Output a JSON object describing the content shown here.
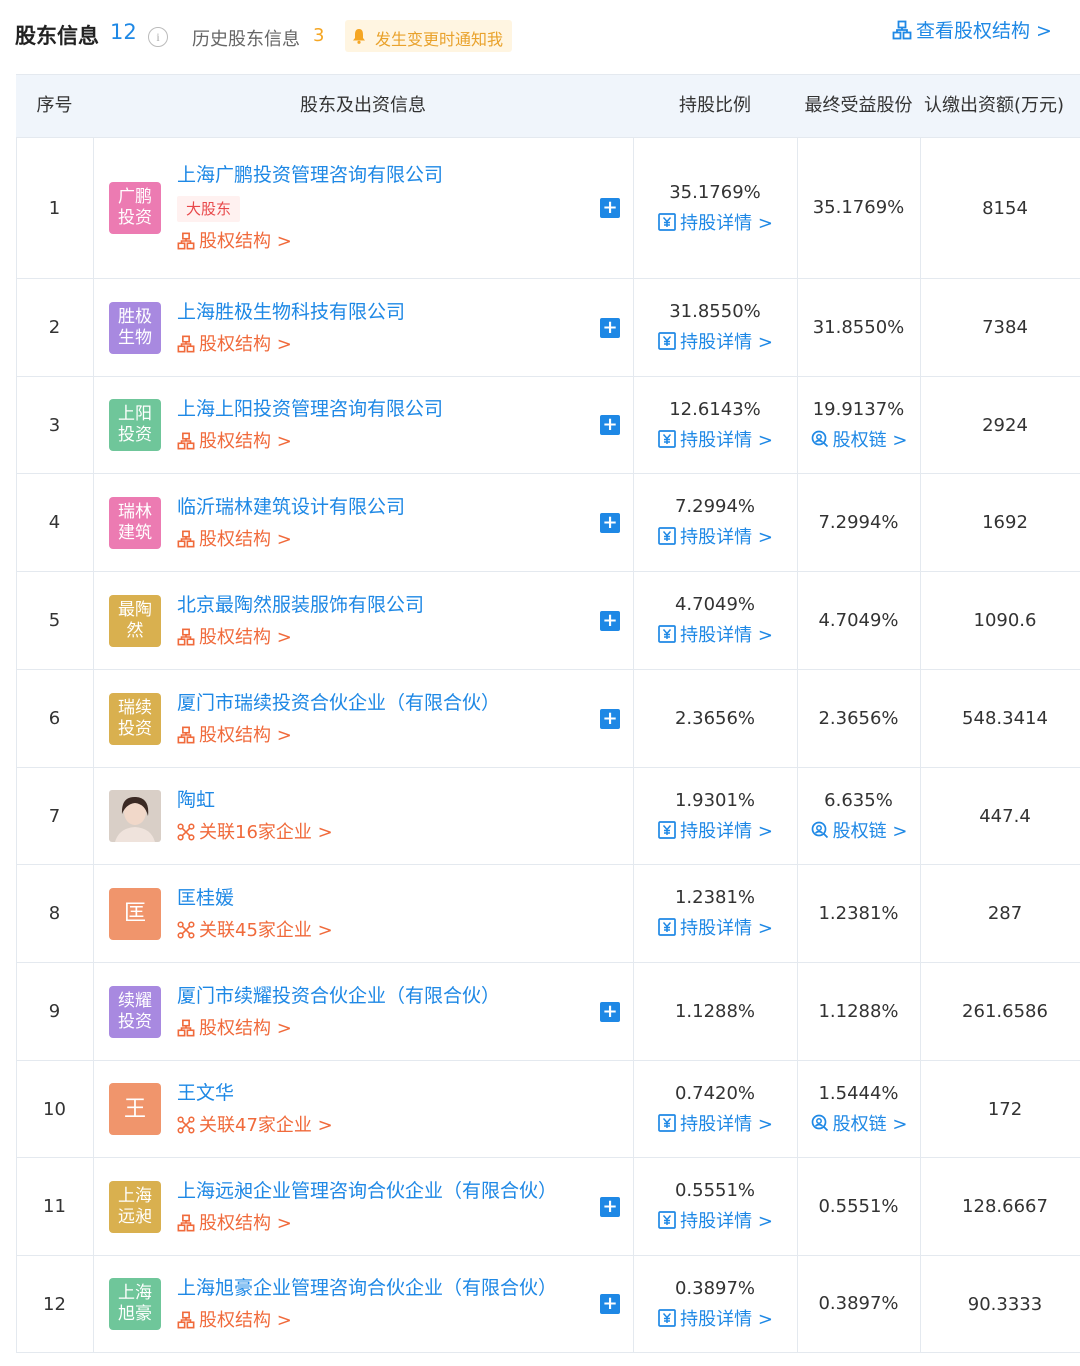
{
  "header": {
    "title": "股东信息",
    "count": "12",
    "info_icon": "i",
    "history_label": "历史股东信息",
    "history_count": "3",
    "notify_label": "发生变更时通知我",
    "view_structure_label": "查看股权结构 >"
  },
  "table": {
    "columns": [
      "序号",
      "股东及出资信息",
      "持股比例",
      "最终受益股份",
      "认缴出资额(万元)"
    ],
    "rows": [
      {
        "index": "1",
        "logo": "广鹏\n投资",
        "logo_color": "#ec7bb2",
        "name": "上海广鹏投资管理咨询有限公司",
        "tag": "大股东",
        "sub_type": "struct",
        "sub_label": "股权结构 >",
        "plus": true,
        "ratio": "35.1769%",
        "ratio_link": "持股详情 >",
        "benefit": "35.1769%",
        "benefit_link": "",
        "capital": "8154",
        "h": 140
      },
      {
        "index": "2",
        "logo": "胜极\n生物",
        "logo_color": "#a889e0",
        "name": "上海胜极生物科技有限公司",
        "tag": "",
        "sub_type": "struct",
        "sub_label": "股权结构 >",
        "plus": true,
        "ratio": "31.8550%",
        "ratio_link": "持股详情 >",
        "benefit": "31.8550%",
        "benefit_link": "",
        "capital": "7384",
        "h": 97
      },
      {
        "index": "3",
        "logo": "上阳\n投资",
        "logo_color": "#6fc69a",
        "name": "上海上阳投资管理咨询有限公司",
        "tag": "",
        "sub_type": "struct",
        "sub_label": "股权结构 >",
        "plus": true,
        "ratio": "12.6143%",
        "ratio_link": "持股详情 >",
        "benefit": "19.9137%",
        "benefit_link": "股权链 >",
        "capital": "2924",
        "h": 96
      },
      {
        "index": "4",
        "logo": "瑞林\n建筑",
        "logo_color": "#ec7bb2",
        "name": "临沂瑞林建筑设计有限公司",
        "tag": "",
        "sub_type": "struct",
        "sub_label": "股权结构 >",
        "plus": true,
        "ratio": "7.2994%",
        "ratio_link": "持股详情 >",
        "benefit": "7.2994%",
        "benefit_link": "",
        "capital": "1692",
        "h": 97
      },
      {
        "index": "5",
        "logo": "最陶\n然",
        "logo_color": "#d9b04f",
        "name": "北京最陶然服装服饰有限公司",
        "tag": "",
        "sub_type": "struct",
        "sub_label": "股权结构 >",
        "plus": true,
        "ratio": "4.7049%",
        "ratio_link": "持股详情 >",
        "benefit": "4.7049%",
        "benefit_link": "",
        "capital": "1090.6",
        "h": 97
      },
      {
        "index": "6",
        "logo": "瑞续\n投资",
        "logo_color": "#d9b04f",
        "name": "厦门市瑞续投资合伙企业（有限合伙）",
        "tag": "",
        "sub_type": "struct",
        "sub_label": "股权结构 >",
        "plus": true,
        "ratio": "2.3656%",
        "ratio_link": "",
        "benefit": "2.3656%",
        "benefit_link": "",
        "capital": "548.3414",
        "h": 97
      },
      {
        "index": "7",
        "logo": "",
        "logo_color": "",
        "avatar": true,
        "name": "陶虹",
        "tag": "",
        "sub_type": "assoc",
        "sub_label": "关联16家企业 >",
        "plus": false,
        "ratio": "1.9301%",
        "ratio_link": "持股详情 >",
        "benefit": "6.635%",
        "benefit_link": "股权链 >",
        "capital": "447.4",
        "h": 96
      },
      {
        "index": "8",
        "logo": "匡",
        "logo_color": "#f0956c",
        "name": "匡桂媛",
        "tag": "",
        "sub_type": "assoc",
        "sub_label": "关联45家企业 >",
        "plus": false,
        "ratio": "1.2381%",
        "ratio_link": "持股详情 >",
        "benefit": "1.2381%",
        "benefit_link": "",
        "capital": "287",
        "h": 97
      },
      {
        "index": "9",
        "logo": "续耀\n投资",
        "logo_color": "#a889e0",
        "name": "厦门市续耀投资合伙企业（有限合伙）",
        "tag": "",
        "sub_type": "struct",
        "sub_label": "股权结构 >",
        "plus": true,
        "ratio": "1.1288%",
        "ratio_link": "",
        "benefit": "1.1288%",
        "benefit_link": "",
        "capital": "261.6586",
        "h": 97
      },
      {
        "index": "10",
        "logo": "王",
        "logo_color": "#f0956c",
        "name": "王文华",
        "tag": "",
        "sub_type": "assoc",
        "sub_label": "关联47家企业 >",
        "plus": false,
        "ratio": "0.7420%",
        "ratio_link": "持股详情 >",
        "benefit": "1.5444%",
        "benefit_link": "股权链 >",
        "capital": "172",
        "h": 96
      },
      {
        "index": "11",
        "logo": "上海\n远昶",
        "logo_color": "#d9b04f",
        "name": "上海远昶企业管理咨询合伙企业（有限合伙）",
        "tag": "",
        "sub_type": "struct",
        "sub_label": "股权结构 >",
        "plus": true,
        "ratio": "0.5551%",
        "ratio_link": "持股详情 >",
        "benefit": "0.5551%",
        "benefit_link": "",
        "capital": "128.6667",
        "h": 97
      },
      {
        "index": "12",
        "logo": "上海\n旭豪",
        "logo_color": "#6fc69a",
        "name": "上海旭豪企业管理咨询合伙企业（有限合伙）",
        "tag": "",
        "sub_type": "struct",
        "sub_label": "股权结构 >",
        "plus": true,
        "ratio": "0.3897%",
        "ratio_link": "持股详情 >",
        "benefit": "0.3897%",
        "benefit_link": "",
        "capital": "90.3333",
        "h": 96
      }
    ]
  }
}
